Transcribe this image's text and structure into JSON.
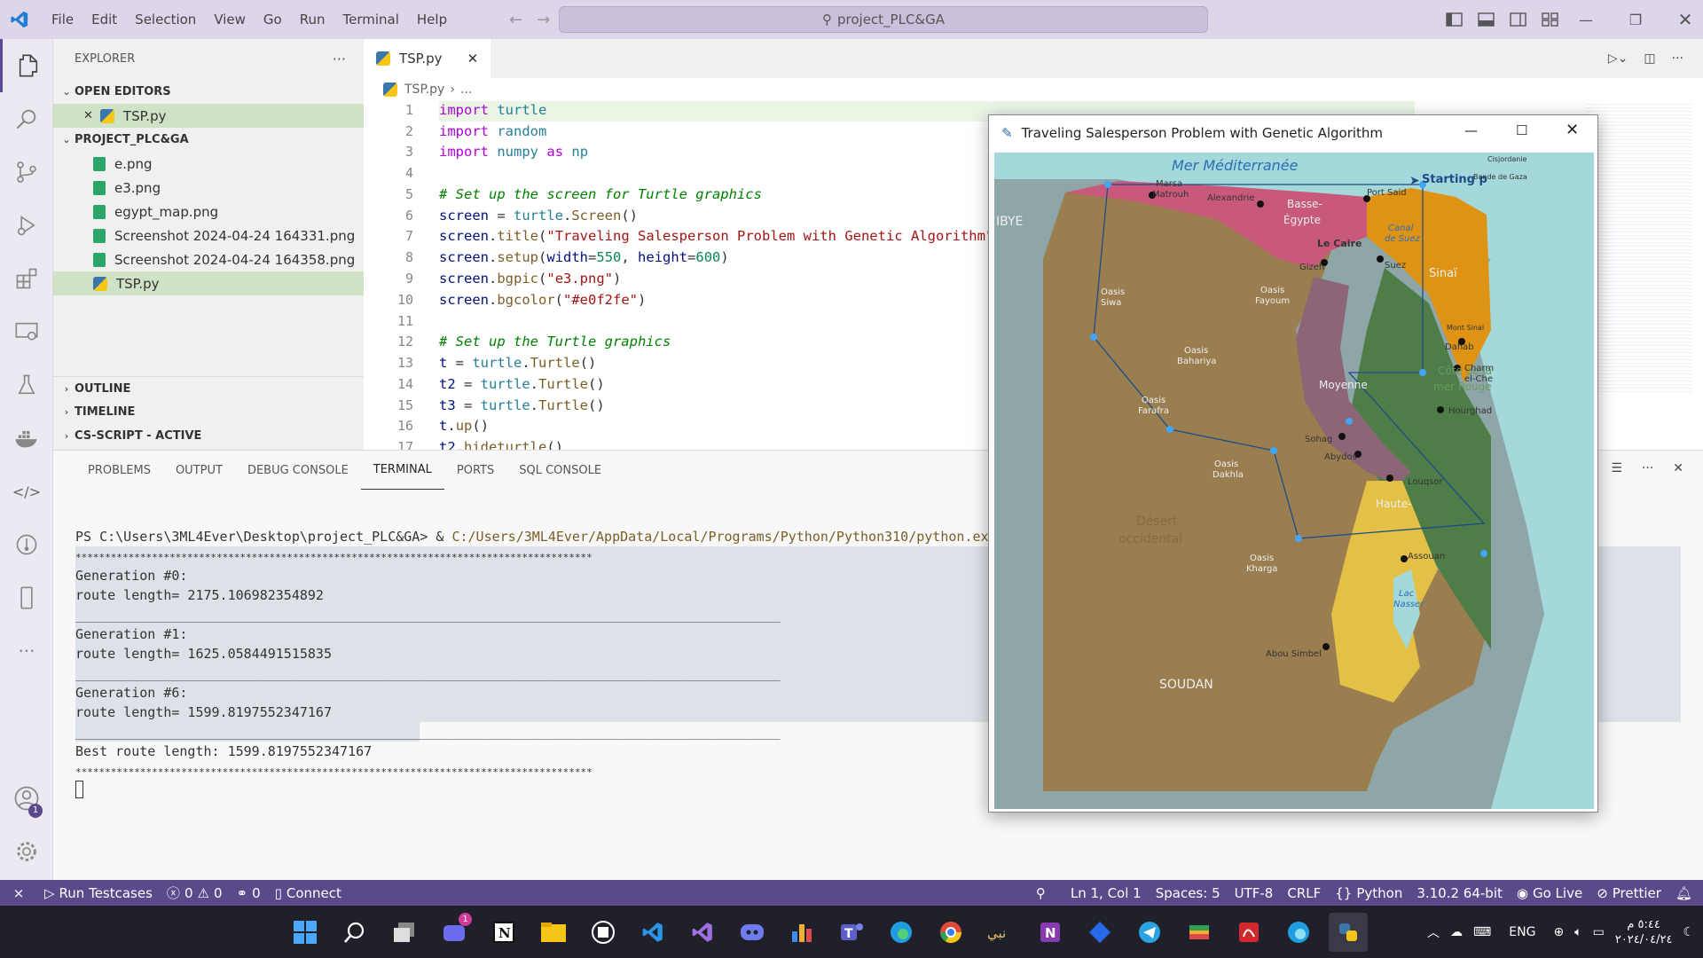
{
  "titlebar": {
    "menu": [
      "File",
      "Edit",
      "Selection",
      "View",
      "Go",
      "Run",
      "Terminal",
      "Help"
    ],
    "search": "project_PLC&GA"
  },
  "sidebar": {
    "title": "EXPLORER",
    "open_editors": "OPEN EDITORS",
    "open_file": "TSP.py",
    "project": "PROJECT_PLC&GA",
    "files": [
      "e.png",
      "e3.png",
      "egypt_map.png",
      "Screenshot 2024-04-24 164331.png",
      "Screenshot 2024-04-24 164358.png",
      "TSP.py"
    ],
    "outline": "OUTLINE",
    "timeline": "TIMELINE",
    "cs_script": "CS-SCRIPT - ACTIVE"
  },
  "activity": {
    "badge": "1"
  },
  "editor": {
    "tab": "TSP.py",
    "breadcrumb_file": "TSP.py",
    "breadcrumb_more": "...",
    "line_numbers": [
      "1",
      "2",
      "3",
      "4",
      "5",
      "6",
      "7",
      "8",
      "9",
      "10",
      "11",
      "12",
      "13",
      "14",
      "15",
      "16",
      "17"
    ]
  },
  "panel": {
    "tabs": [
      "PROBLEMS",
      "OUTPUT",
      "DEBUG CONSOLE",
      "TERMINAL",
      "PORTS",
      "SQL CONSOLE"
    ],
    "prompt": "PS C:\\Users\\3ML4Ever\\Desktop\\project_PLC&GA> & ",
    "python_path": "C:/Users/3ML4Ever/AppData/Local/Programs/Python/Python310/python.exe",
    "stars": "****************************************************************************************",
    "gen0": "Generation #0:",
    "len0": "route length= 2175.106982354892",
    "gen1": "Generation #1:",
    "len1": "route length= 1625.0584491515835",
    "gen6": "Generation #6:",
    "len6": "route length= 1599.8197552347167",
    "best": "Best route length: 1599.8197552347167",
    "rule": "________________________________________________________________________________________"
  },
  "turtle": {
    "title": "Traveling Salesperson Problem with Genetic Algorithm",
    "map_labels": {
      "sea": "Mer Méditerranée",
      "libya": "IBYE",
      "sudan": "SOUDAN",
      "start": "Starting p",
      "marsa": "Marsa",
      "matrouh": "Matrouh",
      "alexandrie": "Alexandrie",
      "port_said": "Port Said",
      "basse": "Basse-",
      "egypte": "Égypte",
      "le_caire": "Le Caire",
      "giza": "Gizeh",
      "suez": "Suez",
      "canal": "Canal",
      "de_suez": "de Suez",
      "sinai": "Sinaï",
      "oasis": "Oasis",
      "siwa": "Siwa",
      "fayoum": "Fayoum",
      "bahariya": "Bahariya",
      "farafra": "Farafra",
      "dakhla": "Dakhla",
      "kharga": "Kharga",
      "desert": "Désert",
      "occidental": "occidental",
      "moyenne": "Moyenne",
      "cote": "Côte de la",
      "mer_rouge": "mer Rouge",
      "mont_sinai": "Mont Sinaï",
      "dahab": "Dahab",
      "charm": "Charm",
      "el_che": "el-Che",
      "hourghada": "Hourghad",
      "sohag": "Sohag",
      "abydos": "Abydos",
      "louqsor": "Louqsor",
      "haute": "Haute-",
      "assouan": "Assouan",
      "lac": "Lac",
      "nasser": "Nasser",
      "abou_simbel": "Abou Simbel",
      "cisjordanie": "Cisjordanie",
      "bande": "Bande de Gaza"
    }
  },
  "statusbar": {
    "run": "Run Testcases",
    "errors": "0",
    "warnings": "0",
    "ports": "0",
    "connect": "Connect",
    "position": "Ln 1, Col 1",
    "spaces": "Spaces: 5",
    "encoding": "UTF-8",
    "eol": "CRLF",
    "language": "Python",
    "version": "3.10.2 64-bit",
    "golive": "Go Live",
    "prettier": "Prettier"
  },
  "taskbar": {
    "lang": "ENG",
    "time": "٥:٤٤ م",
    "date": "٢٠٢٤/٠٤/٢٤",
    "notif": "1"
  },
  "colors": {
    "accent": "#5a4a8c",
    "titlebar": "#ddd6ea"
  }
}
